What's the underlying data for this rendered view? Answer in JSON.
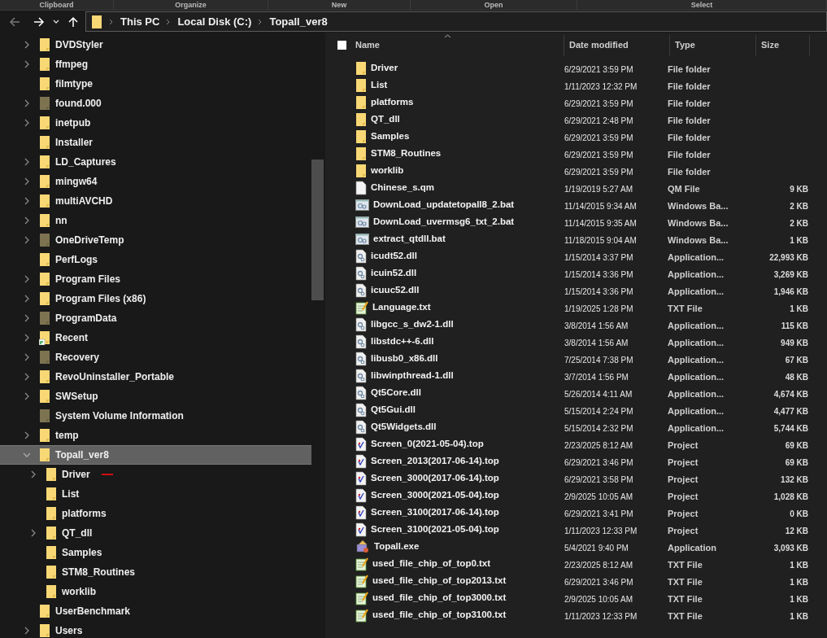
{
  "ribbon_groups": [
    "Clipboard",
    "Organize",
    "New",
    "Open",
    "Select"
  ],
  "address_bar": {
    "breadcrumbs": [
      "This PC",
      "Local Disk (C:)",
      "Topall_ver8"
    ]
  },
  "navigation_pane": {
    "items": [
      {
        "label": "DVDStyler",
        "expandable": true,
        "expanded": false,
        "hidden": false,
        "selected": false
      },
      {
        "label": "ffmpeg",
        "expandable": true,
        "expanded": false,
        "hidden": false,
        "selected": false
      },
      {
        "label": "filmtype",
        "expandable": false,
        "expanded": false,
        "hidden": false,
        "selected": false
      },
      {
        "label": "found.000",
        "expandable": true,
        "expanded": false,
        "hidden": true,
        "selected": false
      },
      {
        "label": "inetpub",
        "expandable": true,
        "expanded": false,
        "hidden": false,
        "selected": false
      },
      {
        "label": "Installer",
        "expandable": false,
        "expanded": false,
        "hidden": false,
        "selected": false
      },
      {
        "label": "LD_Captures",
        "expandable": true,
        "expanded": false,
        "hidden": false,
        "selected": false
      },
      {
        "label": "mingw64",
        "expandable": true,
        "expanded": false,
        "hidden": false,
        "selected": false
      },
      {
        "label": "multiAVCHD",
        "expandable": true,
        "expanded": false,
        "hidden": false,
        "selected": false
      },
      {
        "label": "nn",
        "expandable": true,
        "expanded": false,
        "hidden": false,
        "selected": false
      },
      {
        "label": "OneDriveTemp",
        "expandable": true,
        "expanded": false,
        "hidden": true,
        "selected": false
      },
      {
        "label": "PerfLogs",
        "expandable": false,
        "expanded": false,
        "hidden": false,
        "selected": false
      },
      {
        "label": "Program Files",
        "expandable": true,
        "expanded": false,
        "hidden": false,
        "selected": false
      },
      {
        "label": "Program Files (x86)",
        "expandable": true,
        "expanded": false,
        "hidden": false,
        "selected": false
      },
      {
        "label": "ProgramData",
        "expandable": true,
        "expanded": false,
        "hidden": true,
        "selected": false
      },
      {
        "label": "Recent",
        "expandable": true,
        "expanded": false,
        "hidden": false,
        "shortcut": true,
        "selected": false
      },
      {
        "label": "Recovery",
        "expandable": true,
        "expanded": false,
        "hidden": true,
        "selected": false
      },
      {
        "label": "RevoUninstaller_Portable",
        "expandable": true,
        "expanded": false,
        "hidden": false,
        "selected": false
      },
      {
        "label": "SWSetup",
        "expandable": true,
        "expanded": false,
        "hidden": false,
        "selected": false
      },
      {
        "label": "System Volume Information",
        "expandable": false,
        "expanded": false,
        "hidden": true,
        "selected": false
      },
      {
        "label": "temp",
        "expandable": true,
        "expanded": false,
        "hidden": false,
        "selected": false
      },
      {
        "label": "Topall_ver8",
        "expandable": true,
        "expanded": true,
        "hidden": false,
        "selected": true,
        "children": [
          {
            "label": "Driver",
            "expandable": true,
            "expanded": false,
            "hidden": false,
            "selected": false,
            "marked": true
          },
          {
            "label": "List",
            "expandable": false,
            "expanded": false,
            "hidden": false,
            "selected": false
          },
          {
            "label": "platforms",
            "expandable": false,
            "expanded": false,
            "hidden": false,
            "selected": false
          },
          {
            "label": "QT_dll",
            "expandable": true,
            "expanded": false,
            "hidden": false,
            "selected": false
          },
          {
            "label": "Samples",
            "expandable": false,
            "expanded": false,
            "hidden": false,
            "selected": false
          },
          {
            "label": "STM8_Routines",
            "expandable": false,
            "expanded": false,
            "hidden": false,
            "selected": false
          },
          {
            "label": "worklib",
            "expandable": false,
            "expanded": false,
            "hidden": false,
            "selected": false
          }
        ]
      },
      {
        "label": "UserBenchmark",
        "expandable": false,
        "expanded": false,
        "hidden": false,
        "selected": false
      },
      {
        "label": "Users",
        "expandable": true,
        "expanded": false,
        "hidden": false,
        "selected": false
      }
    ]
  },
  "file_list": {
    "select_all_checked": false,
    "columns": [
      "Name",
      "Date modified",
      "Type",
      "Size"
    ],
    "rows": [
      {
        "kind": "folder",
        "name": "Driver",
        "date": "6/29/2021 3:59 PM",
        "type": "File folder"
      },
      {
        "kind": "folder",
        "name": "List",
        "date": "1/11/2023 12:32 PM",
        "type": "File folder"
      },
      {
        "kind": "folder",
        "name": "platforms",
        "date": "6/29/2021 3:59 PM",
        "type": "File folder"
      },
      {
        "kind": "folder",
        "name": "QT_dll",
        "date": "6/29/2021 2:48 PM",
        "type": "File folder"
      },
      {
        "kind": "folder",
        "name": "Samples",
        "date": "6/29/2021 3:59 PM",
        "type": "File folder"
      },
      {
        "kind": "folder",
        "name": "STM8_Routines",
        "date": "6/29/2021 3:59 PM",
        "type": "File folder"
      },
      {
        "kind": "folder",
        "name": "worklib",
        "date": "6/29/2021 3:59 PM",
        "type": "File folder"
      },
      {
        "kind": "file",
        "name": "Chinese_s.qm",
        "date": "1/19/2019 5:27 AM",
        "type": "QM File",
        "size": "9 KB"
      },
      {
        "kind": "batch",
        "name": "DownLoad_updatetopall8_2.bat",
        "date": "11/14/2015 9:34 AM",
        "type": "Windows Ba...",
        "size": "2 KB"
      },
      {
        "kind": "batch",
        "name": "DownLoad_uvermsg6_txt_2.bat",
        "date": "11/14/2015 9:35 AM",
        "type": "Windows Ba...",
        "size": "2 KB"
      },
      {
        "kind": "batch",
        "name": "extract_qtdll.bat",
        "date": "11/18/2015 9:04 AM",
        "type": "Windows Ba...",
        "size": "1 KB"
      },
      {
        "kind": "dll",
        "name": "icudt52.dll",
        "date": "1/15/2014 3:37 PM",
        "type": "Application...",
        "size": "22,993 KB"
      },
      {
        "kind": "dll",
        "name": "icuin52.dll",
        "date": "1/15/2014 3:36 PM",
        "type": "Application...",
        "size": "3,269 KB"
      },
      {
        "kind": "dll",
        "name": "icuuc52.dll",
        "date": "1/15/2014 3:36 PM",
        "type": "Application...",
        "size": "1,946 KB"
      },
      {
        "kind": "text",
        "name": "Language.txt",
        "date": "1/19/2025 1:28 PM",
        "type": "TXT File",
        "size": "1 KB"
      },
      {
        "kind": "dll",
        "name": "libgcc_s_dw2-1.dll",
        "date": "3/8/2014 1:56 AM",
        "type": "Application...",
        "size": "115 KB"
      },
      {
        "kind": "dll",
        "name": "libstdc++-6.dll",
        "date": "3/8/2014 1:56 AM",
        "type": "Application...",
        "size": "949 KB"
      },
      {
        "kind": "dll",
        "name": "libusb0_x86.dll",
        "date": "7/25/2014 7:38 PM",
        "type": "Application...",
        "size": "67 KB"
      },
      {
        "kind": "dll",
        "name": "libwinpthread-1.dll",
        "date": "3/7/2014 1:56 PM",
        "type": "Application...",
        "size": "48 KB"
      },
      {
        "kind": "dll",
        "name": "Qt5Core.dll",
        "date": "5/26/2014 4:11 AM",
        "type": "Application...",
        "size": "4,674 KB"
      },
      {
        "kind": "dll",
        "name": "Qt5Gui.dll",
        "date": "5/15/2014 2:24 PM",
        "type": "Application...",
        "size": "4,477 KB"
      },
      {
        "kind": "dll",
        "name": "Qt5Widgets.dll",
        "date": "5/15/2014 2:32 PM",
        "type": "Application...",
        "size": "5,744 KB"
      },
      {
        "kind": "project",
        "name": "Screen_0(2021-05-04).top",
        "date": "2/23/2025 8:12 AM",
        "type": "Project",
        "size": "69 KB"
      },
      {
        "kind": "project",
        "name": "Screen_2013(2017-06-14).top",
        "date": "6/29/2021 3:46 PM",
        "type": "Project",
        "size": "69 KB"
      },
      {
        "kind": "project",
        "name": "Screen_3000(2017-06-14).top",
        "date": "6/29/2021 3:58 PM",
        "type": "Project",
        "size": "132 KB"
      },
      {
        "kind": "project",
        "name": "Screen_3000(2021-05-04).top",
        "date": "2/9/2025 10:05 AM",
        "type": "Project",
        "size": "1,028 KB"
      },
      {
        "kind": "project",
        "name": "Screen_3100(2017-06-14).top",
        "date": "6/29/2021 3:41 PM",
        "type": "Project",
        "size": "0 KB"
      },
      {
        "kind": "project",
        "name": "Screen_3100(2021-05-04).top",
        "date": "1/11/2023 12:33 PM",
        "type": "Project",
        "size": "12 KB"
      },
      {
        "kind": "app",
        "name": "Topall.exe",
        "date": "5/4/2021 9:40 PM",
        "type": "Application",
        "size": "3,093 KB"
      },
      {
        "kind": "text",
        "name": "used_file_chip_of_top0.txt",
        "date": "2/23/2025 8:12 AM",
        "type": "TXT File",
        "size": "1 KB"
      },
      {
        "kind": "text",
        "name": "used_file_chip_of_top2013.txt",
        "date": "6/29/2021 3:46 PM",
        "type": "TXT File",
        "size": "1 KB"
      },
      {
        "kind": "text",
        "name": "used_file_chip_of_top3000.txt",
        "date": "2/9/2025 10:05 AM",
        "type": "TXT File",
        "size": "1 KB"
      },
      {
        "kind": "text",
        "name": "used_file_chip_of_top3100.txt",
        "date": "1/11/2023 12:33 PM",
        "type": "TXT File",
        "size": "1 KB"
      }
    ]
  }
}
